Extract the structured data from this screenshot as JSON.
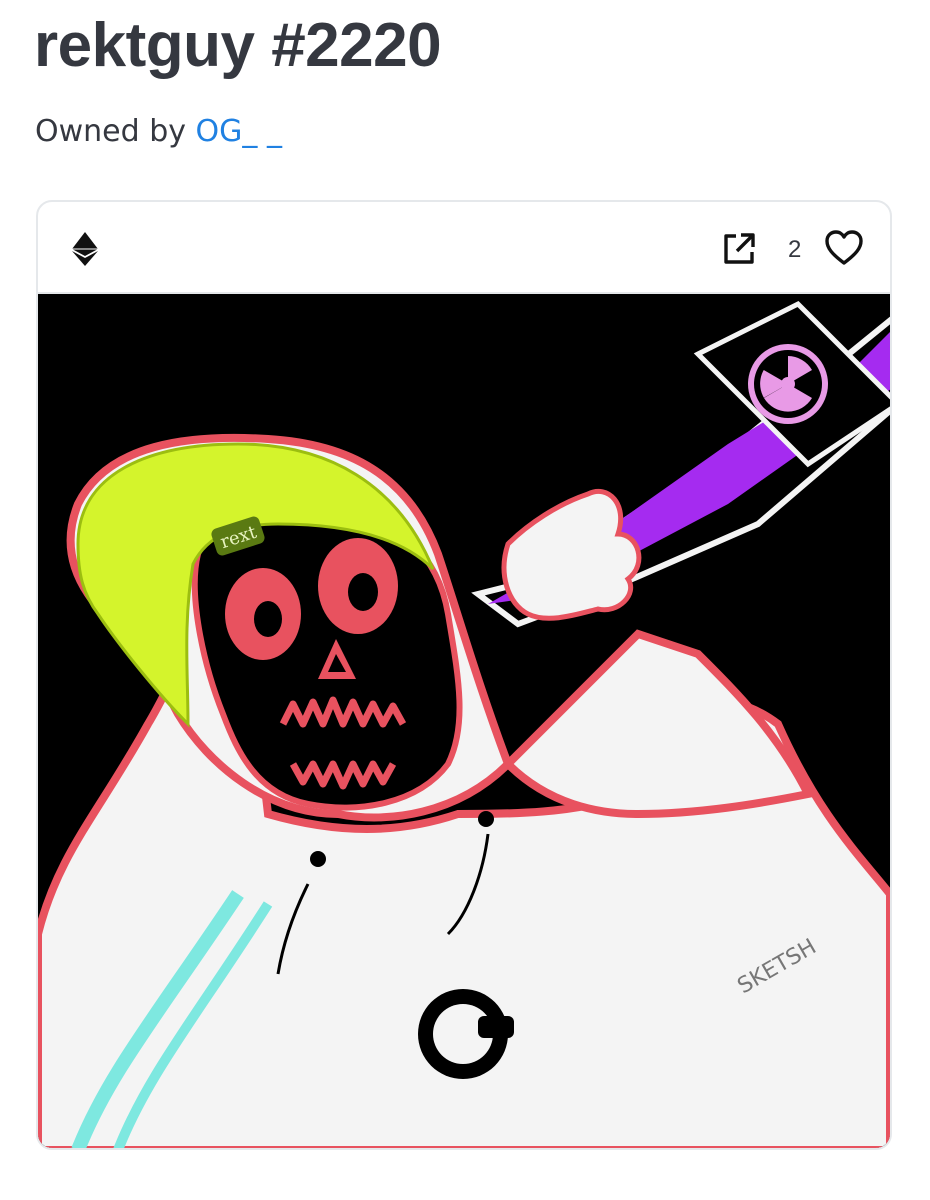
{
  "asset": {
    "title": "rektguy #2220",
    "owned_by_label": "Owned by",
    "owner_name": "OG_ _"
  },
  "card": {
    "chain_icon": "ethereum-icon",
    "external_link_icon": "external-link-icon",
    "favorites_count": "2",
    "favorite_icon": "heart-outline-icon"
  },
  "artwork": {
    "beanie_text": "rext",
    "signature_text": "SKETSH",
    "colors": {
      "background": "#000000",
      "outline": "#e8525f",
      "beanie": "#d4f42c",
      "liquid": "#a52bf0",
      "body": "#ffffff",
      "stripe": "#7ee8e0"
    }
  }
}
